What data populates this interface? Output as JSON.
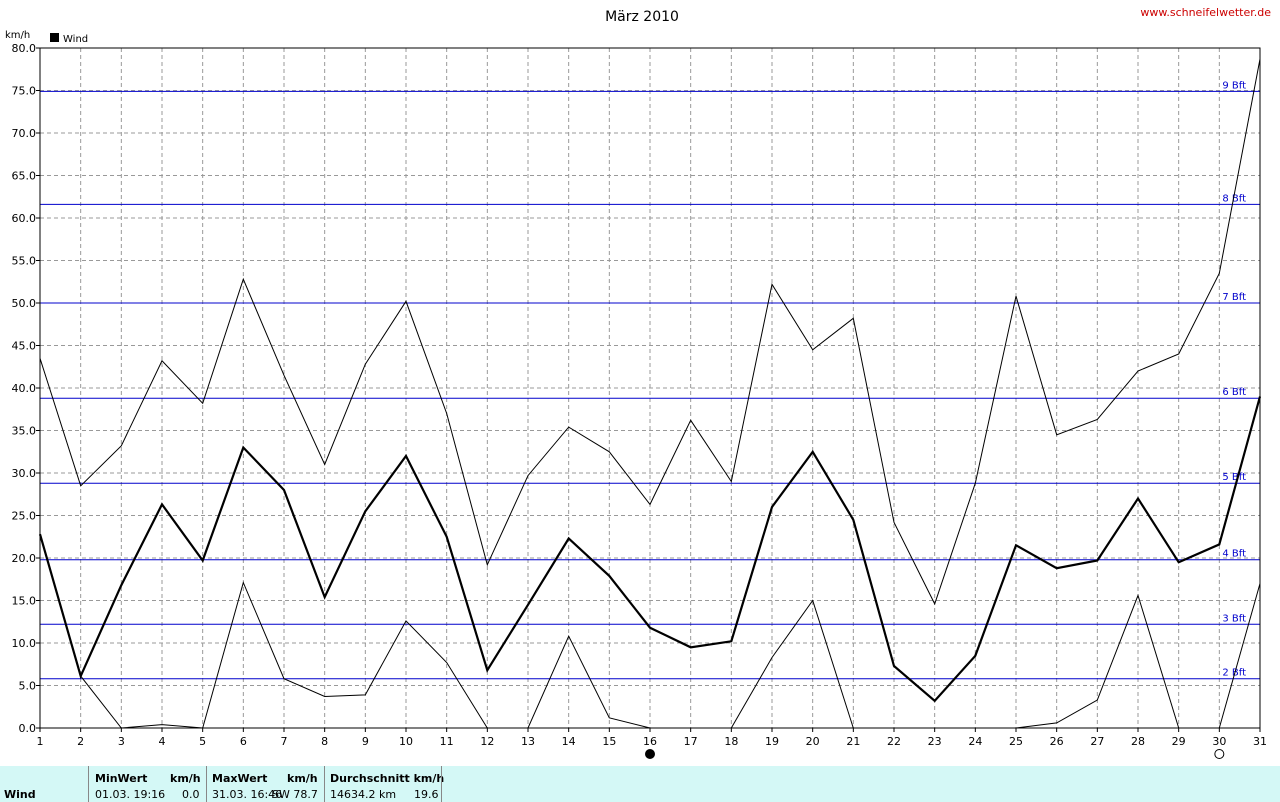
{
  "site": "www.schneifelwetter.de",
  "colors": {
    "bft_lines": "#0000cc",
    "accent_site": "#cc0000",
    "stats_bg": "#d4f8f6"
  },
  "chart_data": {
    "type": "line",
    "title": "März 2010",
    "ylabel": "km/h",
    "ylim": [
      0,
      80
    ],
    "ytick_step": 5,
    "x": [
      1,
      2,
      3,
      4,
      5,
      6,
      7,
      8,
      9,
      10,
      11,
      12,
      13,
      14,
      15,
      16,
      17,
      18,
      19,
      20,
      21,
      22,
      23,
      24,
      25,
      26,
      27,
      28,
      29,
      30,
      31
    ],
    "legend": [
      "Wind"
    ],
    "series": [
      {
        "name": "Wind",
        "role": "average",
        "values": [
          22.8,
          6.1,
          16.8,
          26.3,
          19.7,
          33.0,
          28.0,
          15.4,
          25.5,
          32.0,
          22.5,
          6.8,
          14.5,
          22.3,
          17.9,
          11.8,
          9.5,
          10.2,
          26.0,
          32.5,
          24.5,
          7.3,
          3.2,
          8.5,
          21.5,
          18.8,
          19.7,
          27.0,
          19.5,
          21.6,
          39.0
        ]
      },
      {
        "role": "maximum",
        "values": [
          43.5,
          28.5,
          33.2,
          43.2,
          38.2,
          52.8,
          41.5,
          31.0,
          42.8,
          50.2,
          37.0,
          19.2,
          29.7,
          35.4,
          32.5,
          26.3,
          36.2,
          29.0,
          52.2,
          44.5,
          48.2,
          24.2,
          14.6,
          28.8,
          50.8,
          34.5,
          36.3,
          42.0,
          44.0,
          53.5,
          78.7
        ]
      },
      {
        "role": "minimum",
        "values": [
          22.8,
          6.1,
          0.0,
          0.4,
          0.0,
          17.1,
          5.8,
          3.7,
          3.9,
          12.6,
          7.7,
          0.0,
          0.0,
          10.8,
          1.2,
          0.0,
          null,
          0.0,
          8.3,
          15.0,
          0.0,
          null,
          null,
          null,
          0.0,
          0.6,
          3.3,
          15.6,
          0.0,
          0.0,
          17.0
        ]
      }
    ],
    "beaufort_lines": [
      {
        "label": "2 Bft",
        "value": 5.8
      },
      {
        "label": "3 Bft",
        "value": 12.2
      },
      {
        "label": "4 Bft",
        "value": 19.8
      },
      {
        "label": "5 Bft",
        "value": 28.8
      },
      {
        "label": "6 Bft",
        "value": 38.8
      },
      {
        "label": "7 Bft",
        "value": 50.0
      },
      {
        "label": "8 Bft",
        "value": 61.6
      },
      {
        "label": "9 Bft",
        "value": 74.9
      }
    ],
    "moon_phases": [
      {
        "day": 16,
        "phase": "new"
      },
      {
        "day": 30,
        "phase": "full"
      }
    ],
    "grid": true
  },
  "stats": {
    "row_label": "Wind",
    "min": {
      "header": "MinWert",
      "unit": "km/h",
      "time": "01.03.  19:16",
      "value": "0.0"
    },
    "max": {
      "header": "MaxWert",
      "unit": "km/h",
      "time": "31.03.  16:46",
      "dir_value": "SW 78.7"
    },
    "avg": {
      "header": "Durchschnitt km/h",
      "distance": "14634.2 km",
      "value": "19.6"
    }
  }
}
